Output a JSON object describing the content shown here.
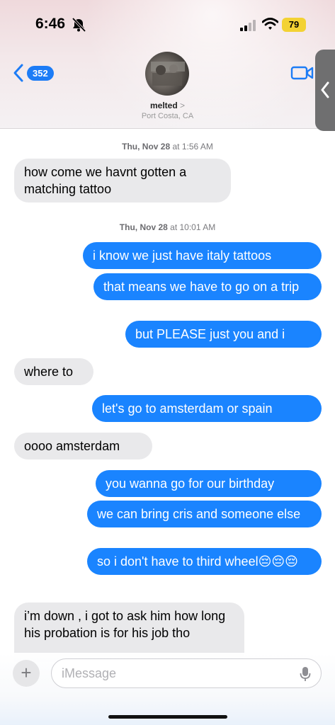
{
  "status_bar": {
    "time": "6:46",
    "battery": "79"
  },
  "header": {
    "back_count": "352",
    "contact_name": "melted",
    "chevron": ">",
    "location": "Port Costa, CA"
  },
  "messages": {
    "ts1": {
      "day": "Thu, Nov 28",
      "at": " at ",
      "time": "1:56 AM"
    },
    "m1": "how come we havnt gotten a matching tattoo",
    "ts2": {
      "day": "Thu, Nov 28",
      "at": " at ",
      "time": "10:01 AM"
    },
    "m2": "i know we just have italy tattoos",
    "m3": "that means we have to go on a trip",
    "m4": "but PLEASE just you and i",
    "m5": "where to",
    "m6": "let's go to amsterdam or spain",
    "m7": "oooo amsterdam",
    "m8": "you wanna go for our birthday",
    "m9": "we can bring cris and someone else",
    "m10": "so i don't have to third wheel😔😔😔",
    "m11": "i’m down , i got to ask him how long his probation is for his job tho"
  },
  "composer": {
    "plus": "+",
    "placeholder": "iMessage"
  },
  "colors": {
    "outgoing": "#1a84ff",
    "incoming": "#e9e9eb",
    "accent": "#1c7cf6"
  },
  "icons": [
    "bell-slash-icon",
    "signal-icon",
    "wifi-icon",
    "back-chevron-icon",
    "video-camera-icon",
    "side-tab-chevron-icon",
    "plus-icon",
    "microphone-icon"
  ]
}
